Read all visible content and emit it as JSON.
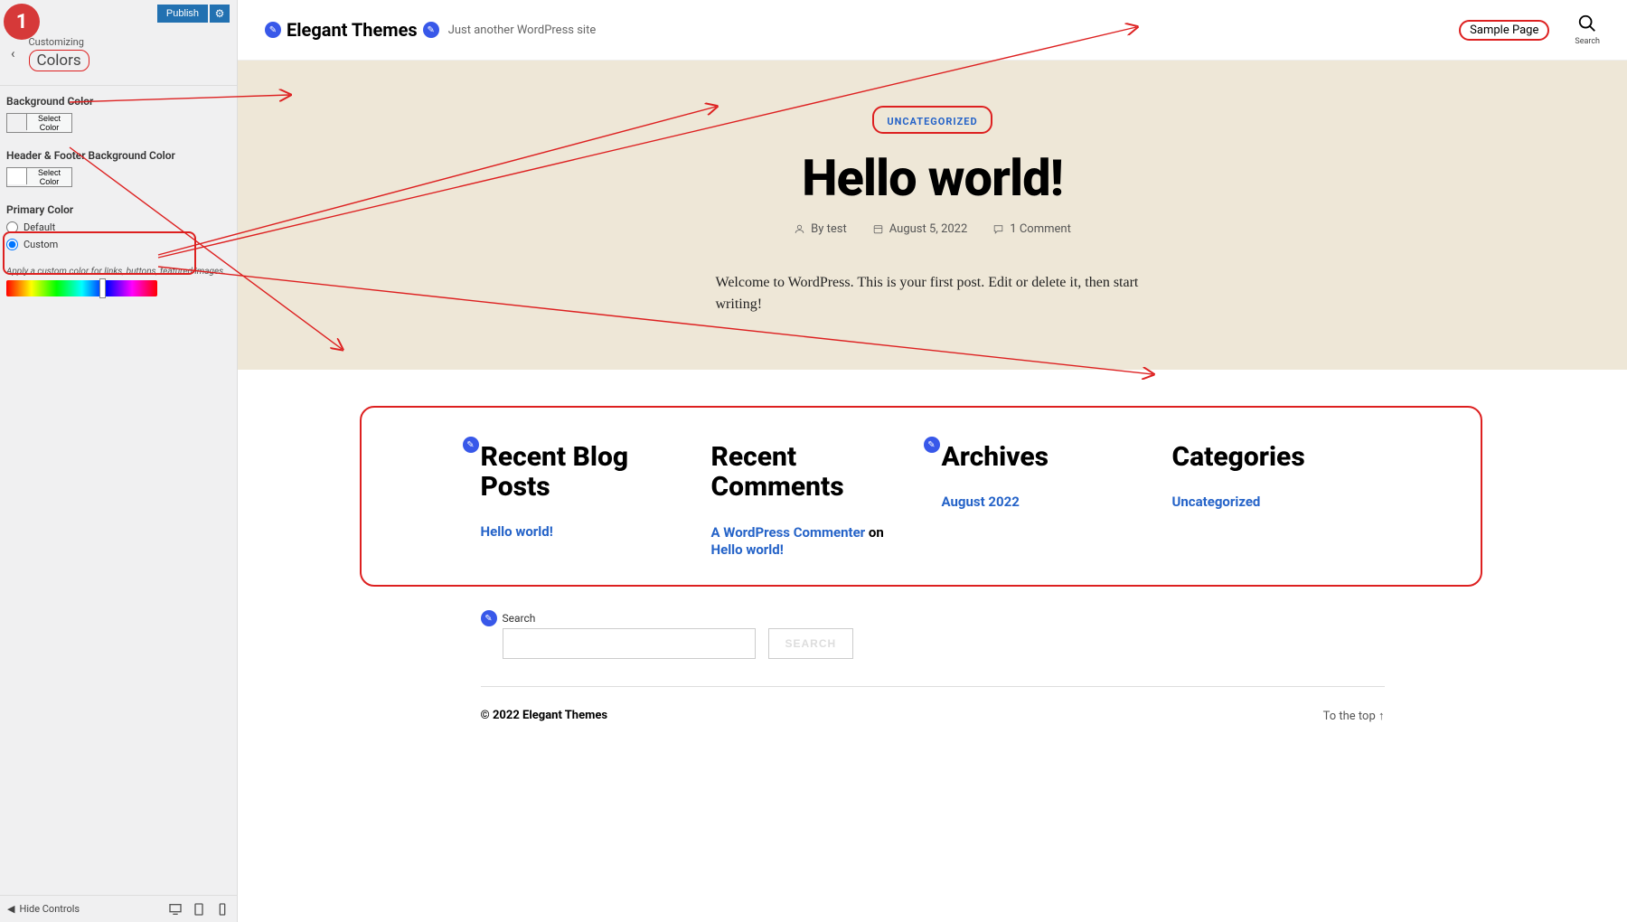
{
  "sidebar": {
    "publish": "Publish",
    "customizing": "Customizing",
    "section": "Colors",
    "bg_label": "Background Color",
    "hf_label": "Header & Footer Background Color",
    "select_color": "Select Color",
    "primary_label": "Primary Color",
    "opt_default": "Default",
    "opt_custom": "Custom",
    "hint": "Apply a custom color for links, buttons, featured images.",
    "hide": "Hide Controls",
    "bg_swatch": "#eee7d7",
    "hf_swatch": "#ffffff"
  },
  "annot": {
    "num": "1"
  },
  "site": {
    "title": "Elegant Themes",
    "tagline": "Just another WordPress site",
    "nav_item": "Sample Page",
    "search_label": "Search"
  },
  "hero": {
    "category": "UNCATEGORIZED",
    "title": "Hello world!",
    "by": "By test",
    "date": "August 5, 2022",
    "comments": "1 Comment",
    "excerpt": "Welcome to WordPress. This is your first post. Edit or delete it, then start writing!"
  },
  "widgets": {
    "recent_posts": {
      "title": "Recent Blog Posts",
      "item": "Hello world!"
    },
    "recent_comments": {
      "title": "Recent Comments",
      "author": "A WordPress Commenter",
      "on": " on ",
      "post": "Hello world!"
    },
    "archives": {
      "title": "Archives",
      "item": "August 2022"
    },
    "categories": {
      "title": "Categories",
      "item": "Uncategorized"
    }
  },
  "search_widget": {
    "label": "Search",
    "button": "SEARCH"
  },
  "footer": {
    "left": "© 2022 Elegant Themes",
    "right": "To the top ↑"
  }
}
